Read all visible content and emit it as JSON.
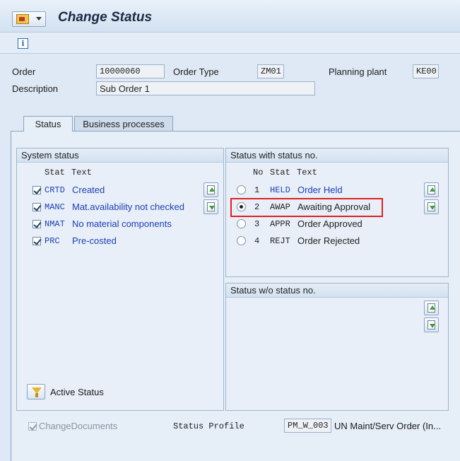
{
  "title": "Change Status",
  "header": {
    "order_label": "Order",
    "order_value": "10000060",
    "order_type_label": "Order Type",
    "order_type_value": "ZM01",
    "planning_plant_label": "Planning plant",
    "planning_plant_value": "KE00",
    "description_label": "Description",
    "description_value": "Sub Order 1"
  },
  "tabs": [
    {
      "label": "Status",
      "active": true
    },
    {
      "label": "Business processes",
      "active": false
    }
  ],
  "system_status": {
    "title": "System status",
    "col_stat": "Stat",
    "col_text": "Text",
    "rows": [
      {
        "code": "CRTD",
        "text": "Created",
        "checked": true
      },
      {
        "code": "MANC",
        "text": "Mat.availability not checked",
        "checked": true
      },
      {
        "code": "NMAT",
        "text": "No material components",
        "checked": true
      },
      {
        "code": "PRC",
        "text": "Pre-costed",
        "checked": true
      }
    ]
  },
  "status_with_no": {
    "title": "Status with status no.",
    "col_no": "No",
    "col_stat": "Stat",
    "col_text": "Text",
    "rows": [
      {
        "no": "1",
        "code": "HELD",
        "text": "Order Held",
        "selected": false
      },
      {
        "no": "2",
        "code": "AWAP",
        "text": "Awaiting Approval",
        "selected": true
      },
      {
        "no": "3",
        "code": "APPR",
        "text": "Order Approved",
        "selected": false
      },
      {
        "no": "4",
        "code": "REJT",
        "text": "Order Rejected",
        "selected": false
      }
    ]
  },
  "status_wo_no": {
    "title": "Status w/o status no."
  },
  "active_status_label": "Active Status",
  "footer": {
    "change_documents_label": "ChangeDocuments",
    "status_profile_label": "Status Profile",
    "status_profile_value": "PM_W_003",
    "status_profile_desc": "UN Maint/Serv Order (In..."
  },
  "colors": {
    "highlight": "#e02020",
    "link_blue": "#1a3fb5"
  }
}
